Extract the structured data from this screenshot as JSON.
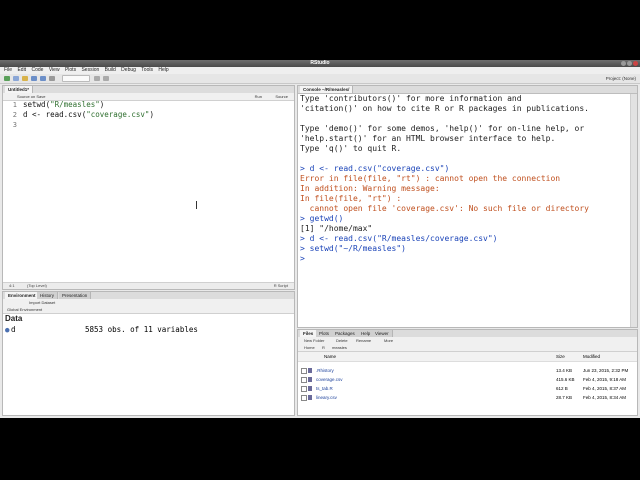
{
  "window": {
    "title": "RStudio"
  },
  "menu": [
    "File",
    "Edit",
    "Code",
    "View",
    "Plots",
    "Session",
    "Build",
    "Debug",
    "Tools",
    "Help"
  ],
  "toolbar": {
    "project_label": "Project: (None)"
  },
  "editor": {
    "tab_label": "Untitled1*",
    "toolbar_labels": {
      "source_on_save": "Source on Save",
      "run": "Run",
      "source": "Source"
    },
    "lines": [
      {
        "num": "1",
        "text": "setwd(\"R/measles\")"
      },
      {
        "num": "2",
        "text": "d <- read.csv(\"coverage.csv\")"
      },
      {
        "num": "3",
        "text": ""
      }
    ],
    "status_left": "4:1",
    "status_mid": "(Top Level)",
    "status_right": "R Script"
  },
  "environment": {
    "tabs": [
      "Environment",
      "History",
      "Presentation"
    ],
    "subbar_import": "Import Dataset",
    "scope": "Global Environment",
    "section": "Data",
    "rows": [
      {
        "name": "d",
        "value": "5853 obs. of 11 variables"
      }
    ]
  },
  "console": {
    "title": "Console ~/R/measles/",
    "lines": [
      {
        "kind": "out",
        "text": "Type 'contributors()' for more information and"
      },
      {
        "kind": "out",
        "text": "'citation()' on how to cite R or R packages in publications."
      },
      {
        "kind": "out",
        "text": ""
      },
      {
        "kind": "out",
        "text": "Type 'demo()' for some demos, 'help()' for on-line help, or"
      },
      {
        "kind": "out",
        "text": "'help.start()' for an HTML browser interface to help."
      },
      {
        "kind": "out",
        "text": "Type 'q()' to quit R."
      },
      {
        "kind": "out",
        "text": ""
      },
      {
        "kind": "prompt",
        "text": "> d <- read.csv(\"coverage.csv\")"
      },
      {
        "kind": "err",
        "text": "Error in file(file, \"rt\") : cannot open the connection"
      },
      {
        "kind": "err",
        "text": "In addition: Warning message:"
      },
      {
        "kind": "err",
        "text": "In file(file, \"rt\") :"
      },
      {
        "kind": "err",
        "text": "  cannot open file 'coverage.csv': No such file or directory"
      },
      {
        "kind": "prompt",
        "text": "> getwd()"
      },
      {
        "kind": "out",
        "text": "[1] \"/home/max\""
      },
      {
        "kind": "prompt",
        "text": "> d <- read.csv(\"R/measles/coverage.csv\")"
      },
      {
        "kind": "prompt",
        "text": "> setwd(\"~/R/measles\")"
      },
      {
        "kind": "prompt",
        "text": ">"
      }
    ]
  },
  "files": {
    "tabs": [
      "Files",
      "Plots",
      "Packages",
      "Help",
      "Viewer"
    ],
    "toolbar": [
      "New Folder",
      "Delete",
      "Rename",
      "More"
    ],
    "path": [
      "Home",
      "R",
      "measles"
    ],
    "headers": {
      "name": "Name",
      "size": "Size",
      "modified": "Modified"
    },
    "rows": [
      {
        "name": ".Rhistory",
        "size": "13.4 KB",
        "modified": "Jun 23, 2015, 2:32 PM"
      },
      {
        "name": "coverage.csv",
        "size": "415.6 KB",
        "modified": "Feb 4, 2015, 9:18 AM"
      },
      {
        "name": "ts_tab.R",
        "size": "612 B",
        "modified": "Feb 4, 2015, 8:37 AM"
      },
      {
        "name": "lineary.csv",
        "size": "28.7 KB",
        "modified": "Feb 4, 2015, 8:34 AM"
      }
    ]
  },
  "colors": {
    "prompt": "#1b44b8",
    "error": "#c0501f",
    "string": "#2f6f2f"
  }
}
